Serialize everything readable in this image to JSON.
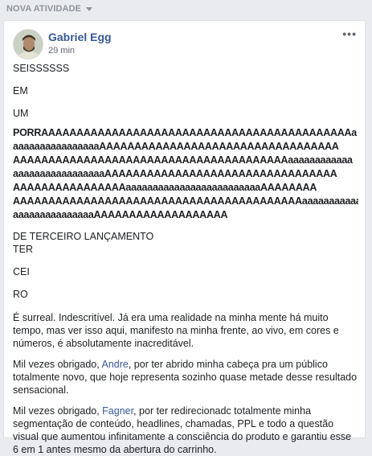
{
  "header": {
    "section_label": "NOVA ATIVIDADE"
  },
  "post": {
    "author": "Gabriel Egg",
    "time": "29 min",
    "more_label": "•••",
    "lines": [
      "SEISSSSSS",
      "EM",
      "UM"
    ],
    "shout_lines": [
      "PORRAAAAAAAAAAAAAAAAAAAAAAAAAAAAAAAAAAAAAAAAAAAAa",
      "aaaaaaaaaaaaaaaaAAAAAAAAAAAAAAAAAAAAAAAAAAAAAAAAAA",
      "AAAAAAAAAAAAAAAAAAAAAAAAAAAAAAAAAAAAAAAaaaaaaaaaaaa",
      "aaaaaaaaaaaaaaaaaAAAAAAAAAAAAAAAAAAAAAAAAAAAAAAAAA",
      "AAAAAAAAAAAAAAAAaaaaaaaaaaaaaaaaaaaaaaaaaAAAAAAAA",
      "AAAAAAAAAAAAAAAAAAAAAAAAAAAAAAAAAAAAAAAAAaaaaaaaaaaa",
      "aaaaaaaaaaaaaaaAAAAAAAAAAAAAAAAAAA"
    ],
    "line_after_shout": "DE TERCEIRO LANÇAMENTO",
    "syllables": [
      "TER",
      "CEI",
      "RO"
    ],
    "para1": "É surreal. Indescritível. Já era uma realidade na minha mente há muito tempo, mas ver isso aqui, manifesto na minha frente, ao vivo, em cores e números, é absolutamente inacreditável.",
    "para2": {
      "prefix": "Mil vezes obrigado, ",
      "mention": "Andre",
      "suffix": ", por ter abrido minha cabeça pra um público totalmente novo, que hoje representa sozinho quase metade desse resultado sensacional."
    },
    "para3": {
      "prefix": "Mil vezes obrigado, ",
      "mention": "Fagner",
      "suffix": ", por ter redirecionadc totalmente minha segmentação de conteúdo, headlines, chamadas, PPL e todo a questão visual que aumentou infinitamente a consciência do produto e garantiu esse 6 em 1 antes mesmo da abertura do carrinho."
    }
  }
}
